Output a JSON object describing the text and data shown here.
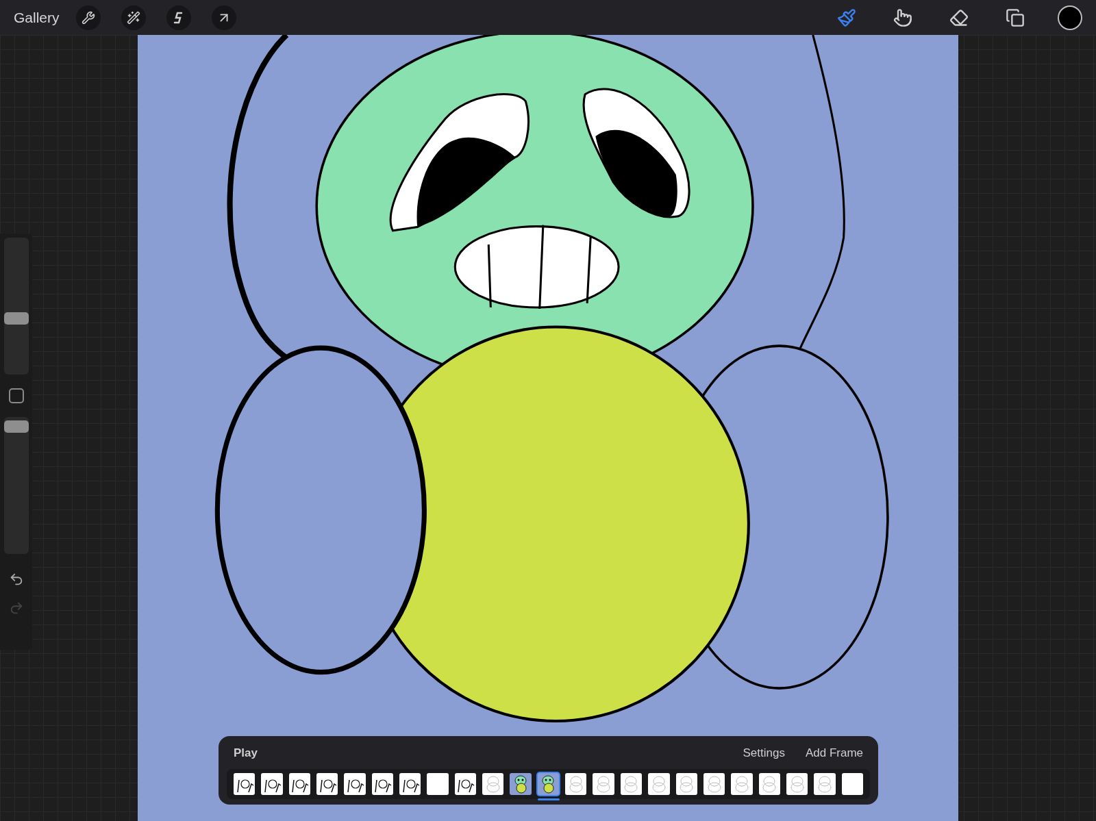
{
  "top_bar": {
    "gallery": "Gallery",
    "tools": [
      {
        "kind": "brush",
        "selected": true
      },
      {
        "kind": "smudge",
        "selected": false
      },
      {
        "kind": "eraser",
        "selected": false
      }
    ]
  },
  "sidebar": {
    "brush_size": {
      "level": 0.4
    },
    "opacity": {
      "level": 0.97
    },
    "undo": {
      "disabled": false
    },
    "redo": {
      "disabled": true
    }
  },
  "timeline": {
    "play": "Play",
    "settings": "Settings",
    "add_frame": "Add Frame",
    "frames": [
      {
        "kind": "sketch",
        "selected": false
      },
      {
        "kind": "sketch",
        "selected": false
      },
      {
        "kind": "sketch",
        "selected": false
      },
      {
        "kind": "sketch",
        "selected": false
      },
      {
        "kind": "sketch",
        "selected": false
      },
      {
        "kind": "sketch",
        "selected": false
      },
      {
        "kind": "sketch",
        "selected": false
      },
      {
        "kind": "blank",
        "selected": false
      },
      {
        "kind": "sketch",
        "selected": false
      },
      {
        "kind": "faint",
        "selected": false
      },
      {
        "kind": "colored",
        "selected": false
      },
      {
        "kind": "colored",
        "selected": true
      },
      {
        "kind": "faint",
        "selected": false
      },
      {
        "kind": "faint",
        "selected": false
      },
      {
        "kind": "faint",
        "selected": false
      },
      {
        "kind": "faint",
        "selected": false
      },
      {
        "kind": "faint",
        "selected": false
      },
      {
        "kind": "faint",
        "selected": false
      },
      {
        "kind": "faint",
        "selected": false
      },
      {
        "kind": "faint",
        "selected": false
      },
      {
        "kind": "faint",
        "selected": false
      },
      {
        "kind": "faint",
        "selected": false
      },
      {
        "kind": "blank",
        "selected": false
      }
    ]
  }
}
